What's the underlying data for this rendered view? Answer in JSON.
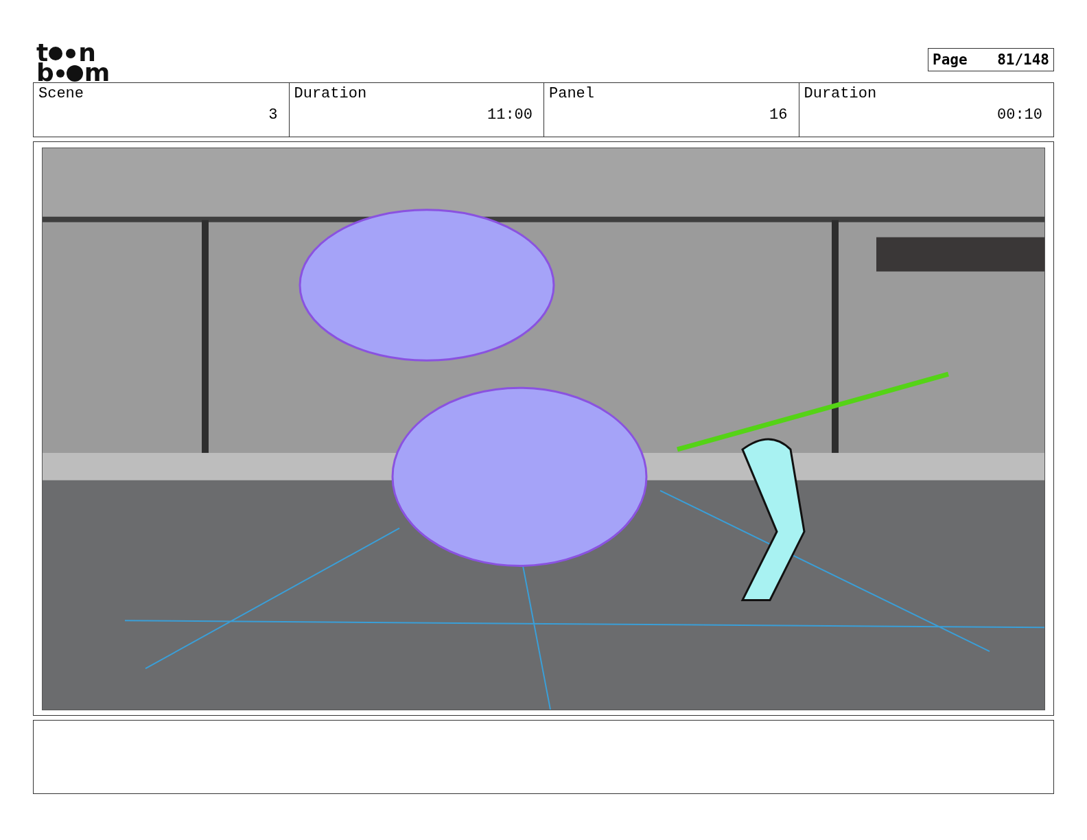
{
  "logo": {
    "top": [
      "t",
      "n"
    ],
    "bottom": [
      "b",
      "m"
    ]
  },
  "page": {
    "label": "Page",
    "value": "81/148"
  },
  "fields": [
    {
      "label": "Scene",
      "value": "3"
    },
    {
      "label": "Duration",
      "value": "11:00"
    },
    {
      "label": "Panel",
      "value": "16"
    },
    {
      "label": "Duration",
      "value": "00:10"
    }
  ]
}
